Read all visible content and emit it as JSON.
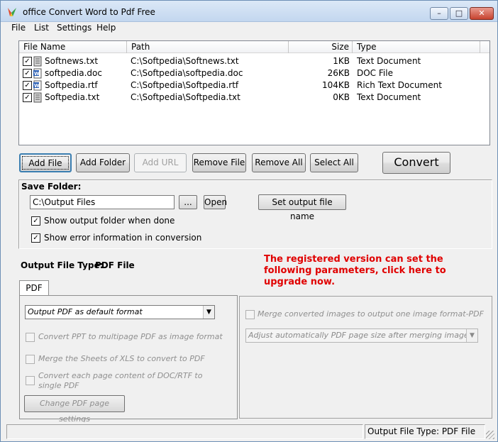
{
  "window": {
    "title": "office Convert Word to Pdf Free",
    "controls": {
      "minimize": "–",
      "maximize": "□",
      "close": "✕"
    }
  },
  "menu": [
    "File",
    "List",
    "Settings",
    "Help"
  ],
  "file_list": {
    "columns": [
      "File Name",
      "Path",
      "Size",
      "Type"
    ],
    "rows": [
      {
        "checked": true,
        "icon": "text-file-icon",
        "name": "Softnews.txt",
        "path": "C:\\Softpedia\\Softnews.txt",
        "size": "1KB",
        "type": "Text Document"
      },
      {
        "checked": true,
        "icon": "word-doc-icon",
        "name": "softpedia.doc",
        "path": "C:\\Softpedia\\softpedia.doc",
        "size": "26KB",
        "type": "DOC File"
      },
      {
        "checked": true,
        "icon": "word-doc-icon",
        "name": "Softpedia.rtf",
        "path": "C:\\Softpedia\\Softpedia.rtf",
        "size": "104KB",
        "type": "Rich Text Document"
      },
      {
        "checked": true,
        "icon": "text-file-icon",
        "name": "Softpedia.txt",
        "path": "C:\\Softpedia\\Softpedia.txt",
        "size": "0KB",
        "type": "Text Document"
      }
    ]
  },
  "toolbar": {
    "add_file": "Add File",
    "add_folder": "Add Folder",
    "add_url": "Add URL",
    "remove_file": "Remove File",
    "remove_all": "Remove All",
    "select_all": "Select All",
    "convert": "Convert"
  },
  "save_folder": {
    "label": "Save Folder:",
    "path": "C:\\Output Files",
    "browse": "...",
    "open": "Open",
    "set_output_name": "Set output file name",
    "show_output_folder": "Show output folder when done",
    "show_error_info": "Show error information in conversion",
    "show_output_folder_checked": true,
    "show_error_info_checked": true
  },
  "output_type": {
    "label": "Output File Type:",
    "value": "PDF File"
  },
  "upgrade_notice": "The registered version can set the following parameters, click here to upgrade now.",
  "pdf_tab": {
    "tab_label": "PDF",
    "format_select": "Output PDF as default format",
    "convert_ppt": "Convert PPT to multipage PDF as image format",
    "merge_xls": "Merge the Sheets of XLS to convert to PDF",
    "convert_each_page": "Convert each page content of DOC/RTF to single PDF",
    "change_settings": "Change PDF page settings",
    "merge_images": "Merge converted images to output one image format-PDF",
    "adjust_page_size": "Adjust automatically PDF page size after merging images to Pi"
  },
  "status": {
    "left": "",
    "right": "Output File Type:  PDF File"
  },
  "colors": {
    "upgrade_text": "#e00000",
    "title_gradient": "#c3d7ef",
    "close_button": "#c7432f"
  }
}
